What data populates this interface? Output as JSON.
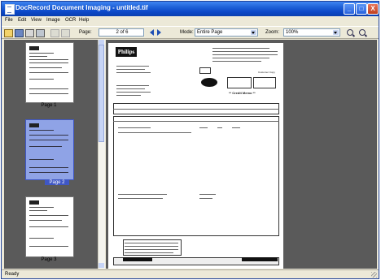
{
  "window": {
    "title": "DocRecord Document Imaging - untitled.tif"
  },
  "title_buttons": {
    "minimize": "_",
    "maximize": "□",
    "close": "X"
  },
  "menu": [
    "File",
    "Edit",
    "View",
    "Image",
    "OCR",
    "Help"
  ],
  "toolbar": {
    "page_label": "Page:",
    "page_value": "2 of 6",
    "mode_label": "Mode:",
    "mode_value": "Entire Page",
    "zoom_label": "Zoom:",
    "zoom_value": "100%"
  },
  "thumbnails": [
    {
      "label": "Page 1",
      "selected": false
    },
    {
      "label": "Page 2",
      "selected": true
    },
    {
      "label": "Page 3",
      "selected": false
    }
  ],
  "document": {
    "logo_text": "Philips",
    "credit_memo": "** Credit Memo **",
    "customer_copy": "Customer Copy"
  },
  "status": {
    "text": "Ready"
  }
}
